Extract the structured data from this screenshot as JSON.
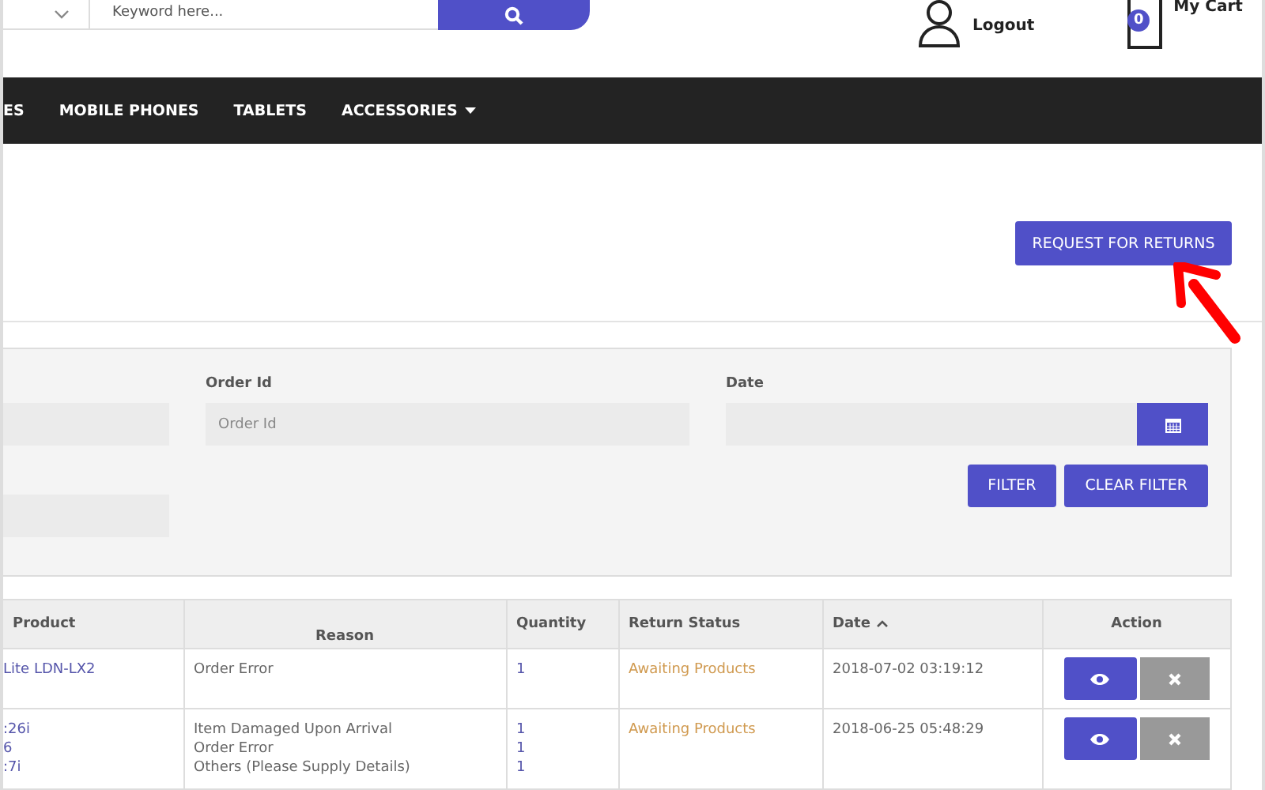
{
  "header": {
    "search": {
      "placeholder": "Keyword here..."
    },
    "account": {
      "logout": "Logout"
    },
    "cart": {
      "count": "0",
      "label": "My Cart"
    }
  },
  "nav": {
    "items": [
      {
        "label": "ES",
        "dropdown": false
      },
      {
        "label": "MOBILE PHONES",
        "dropdown": false
      },
      {
        "label": "TABLETS",
        "dropdown": false
      },
      {
        "label": "ACCESSORIES",
        "dropdown": true
      }
    ]
  },
  "request_button": "REQUEST FOR RETURNS",
  "filters": {
    "order_id": {
      "label": "Order Id",
      "placeholder": "Order Id"
    },
    "date": {
      "label": "Date"
    },
    "buttons": [
      "FILTER",
      "CLEAR FILTER"
    ]
  },
  "table": {
    "columns": [
      {
        "label": "Product",
        "sorted": false
      },
      {
        "label": "Reason",
        "sorted": false
      },
      {
        "label": "Quantity",
        "sorted": false
      },
      {
        "label": "Return Status",
        "sorted": false
      },
      {
        "label": "Date",
        "sorted": true
      },
      {
        "label": "Action",
        "sorted": false
      }
    ],
    "rows": [
      {
        "product": [
          "Lite LDN-LX2"
        ],
        "reason": [
          "Order Error"
        ],
        "quantity": [
          "1"
        ],
        "status": "Awaiting Products",
        "date": "2018-07-02 03:19:12"
      },
      {
        "product": [
          ":26i",
          "6",
          ":7i"
        ],
        "reason": [
          "Item Damaged Upon Arrival",
          "Order Error",
          "Others (Please Supply Details)"
        ],
        "quantity": [
          "1",
          "1",
          "1"
        ],
        "status": "Awaiting Products",
        "date": "2018-06-25 05:48:29"
      }
    ]
  }
}
